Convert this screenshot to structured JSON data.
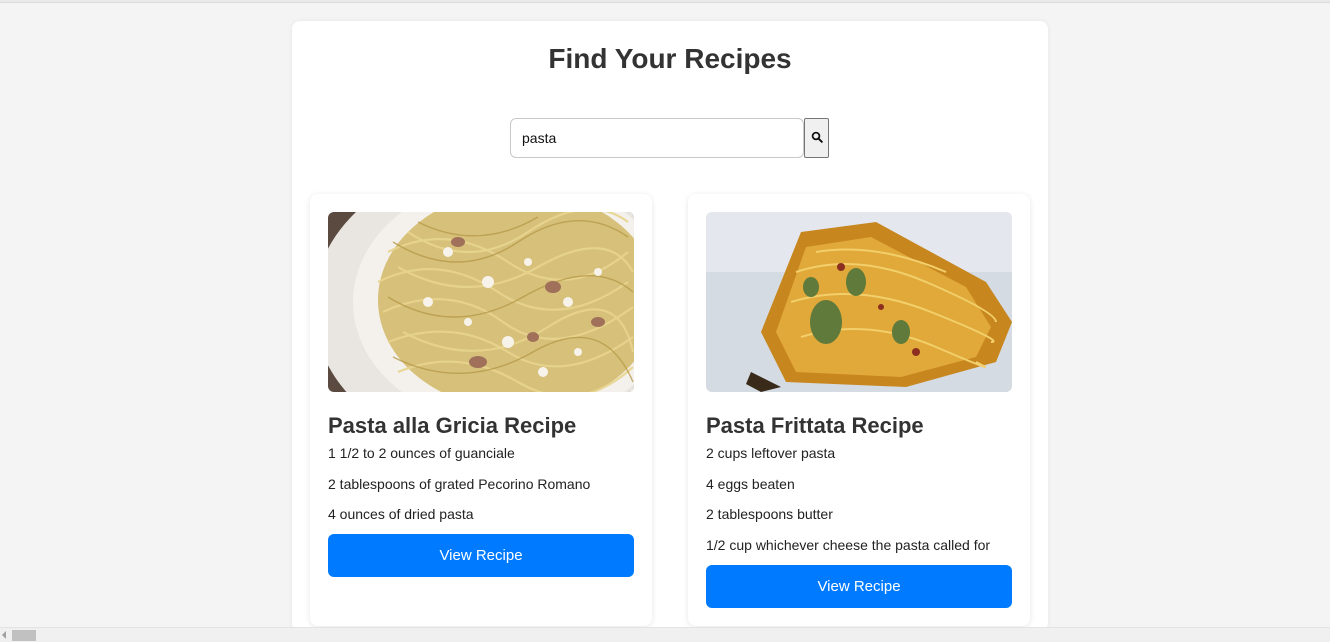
{
  "page": {
    "title": "Find Your Recipes"
  },
  "search": {
    "value": "pasta",
    "button_icon": "search-icon"
  },
  "recipes": [
    {
      "title": "Pasta alla Gricia Recipe",
      "image": "spaghetti-with-guanciale-photo",
      "ingredients": [
        "1 1/2 to 2 ounces of guanciale",
        "2 tablespoons of grated Pecorino Romano",
        "4 ounces of dried pasta"
      ],
      "button_label": "View Recipe"
    },
    {
      "title": "Pasta Frittata Recipe",
      "image": "pasta-frittata-photo",
      "ingredients": [
        "2 cups leftover pasta",
        "4 eggs beaten",
        "2 tablespoons butter",
        "1/2 cup whichever cheese the pasta called for"
      ],
      "button_label": "View Recipe"
    }
  ],
  "colors": {
    "accent": "#007bff",
    "page_background": "#f4f4f4",
    "card_background": "#ffffff",
    "text": "#333333"
  }
}
